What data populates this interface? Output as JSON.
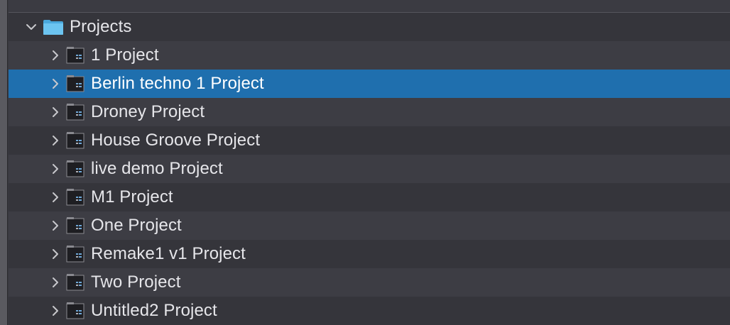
{
  "browser": {
    "root": {
      "label": "Projects",
      "icon": "folder-icon",
      "expanded": true,
      "icon_color": "#5bb8e8"
    },
    "items": [
      {
        "label": "1 Project",
        "selected": false
      },
      {
        "label": "Berlin techno 1 Project",
        "selected": true
      },
      {
        "label": "Droney Project",
        "selected": false
      },
      {
        "label": "House Groove Project",
        "selected": false
      },
      {
        "label": "live demo Project",
        "selected": false
      },
      {
        "label": "M1 Project",
        "selected": false
      },
      {
        "label": "One Project",
        "selected": false
      },
      {
        "label": "Remake1 v1 Project",
        "selected": false
      },
      {
        "label": "Two Project",
        "selected": false
      },
      {
        "label": "Untitled2 Project",
        "selected": false
      }
    ],
    "colors": {
      "selection": "#1f6fae",
      "row_even": "#3d3d44",
      "row_odd": "#35353b",
      "text": "#e6e6ea"
    }
  }
}
